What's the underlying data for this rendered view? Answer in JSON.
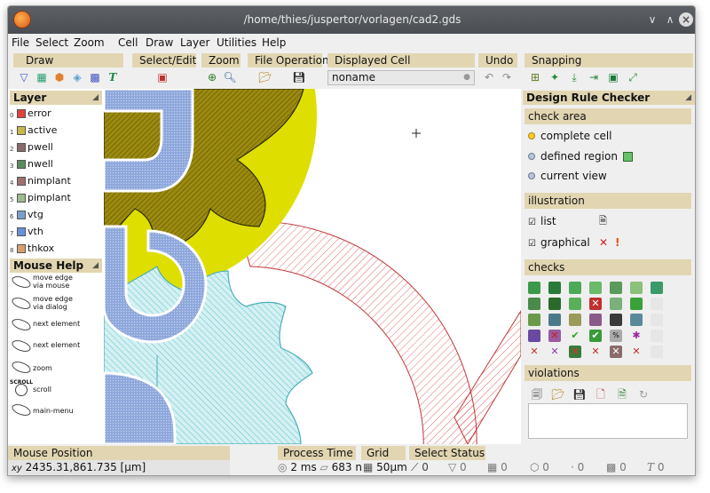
{
  "window": {
    "title": "/home/thies/juspertor/vorlagen/cad2.gds"
  },
  "menu": [
    "File",
    "Select",
    "Zoom",
    "Cell",
    "Draw",
    "Layer",
    "Utilities",
    "Help"
  ],
  "toolbar": {
    "draw_label": "Draw",
    "select_edit_label": "Select/Edit",
    "zoom_label": "Zoom",
    "file_operation_label": "File Operation",
    "displayed_cell_label": "Displayed Cell",
    "displayed_cell_value": "noname",
    "undo_label": "Undo",
    "snapping_label": "Snapping"
  },
  "layer_panel": {
    "title": "Layer",
    "layers": [
      {
        "key": "0",
        "name": "error",
        "color": "#e04040"
      },
      {
        "key": "1",
        "name": "active",
        "color": "#c8b84a"
      },
      {
        "key": "2",
        "name": "pwell",
        "color": "#8a6a6a"
      },
      {
        "key": "3",
        "name": "nwell",
        "color": "#5c8a5c"
      },
      {
        "key": "4",
        "name": "nimplant",
        "color": "#a07070"
      },
      {
        "key": "5",
        "name": "pimplant",
        "color": "#a0b890"
      },
      {
        "key": "6",
        "name": "vtg",
        "color": "#7aa0c8"
      },
      {
        "key": "7",
        "name": "vth",
        "color": "#6a90d8"
      },
      {
        "key": "8",
        "name": "thkox",
        "color": "#d8a070"
      }
    ]
  },
  "mouse_help": {
    "title": "Mouse Help",
    "items": [
      {
        "text1": "move edge",
        "text2": "via mouse"
      },
      {
        "text1": "move edge",
        "text2": "via dialog"
      },
      {
        "text1": "next element",
        "text2": ""
      },
      {
        "text1": "next element",
        "text2": ""
      },
      {
        "text1": "zoom",
        "text2": ""
      },
      {
        "text1": "scroll",
        "text2": ""
      },
      {
        "text1": "main-menu",
        "text2": ""
      }
    ],
    "scroll_caption": "SCROLL"
  },
  "drc": {
    "title": "Design Rule Checker",
    "check_area_label": "check area",
    "areas": [
      "complete cell",
      "defined region",
      "current view"
    ],
    "selected_area": "complete cell",
    "illustration_label": "illustration",
    "illus_list": "list",
    "illus_graphical": "graphical",
    "checks_label": "checks",
    "violations_label": "violations"
  },
  "status": {
    "mouse_position_label": "Mouse Position",
    "mouse_position_axes": "xy",
    "mouse_position_value": "2435.31,861.735 [µm]",
    "process_time_label": "Process Time",
    "process_time_value": "2 ms",
    "process_count_value": "683 n",
    "grid_label": "Grid",
    "grid_value": "50µm",
    "select_status_label": "Select Status",
    "select_counts": [
      "0",
      "0",
      "0",
      "0",
      "0",
      "0",
      "0"
    ]
  },
  "colors": {
    "panel_header": "#e2d6b2",
    "gear_yellow": "#dede00",
    "gear_cyan": "#9fdbe0",
    "letter_blue": "#8fa8dc",
    "hatch_red": "#d94545"
  }
}
